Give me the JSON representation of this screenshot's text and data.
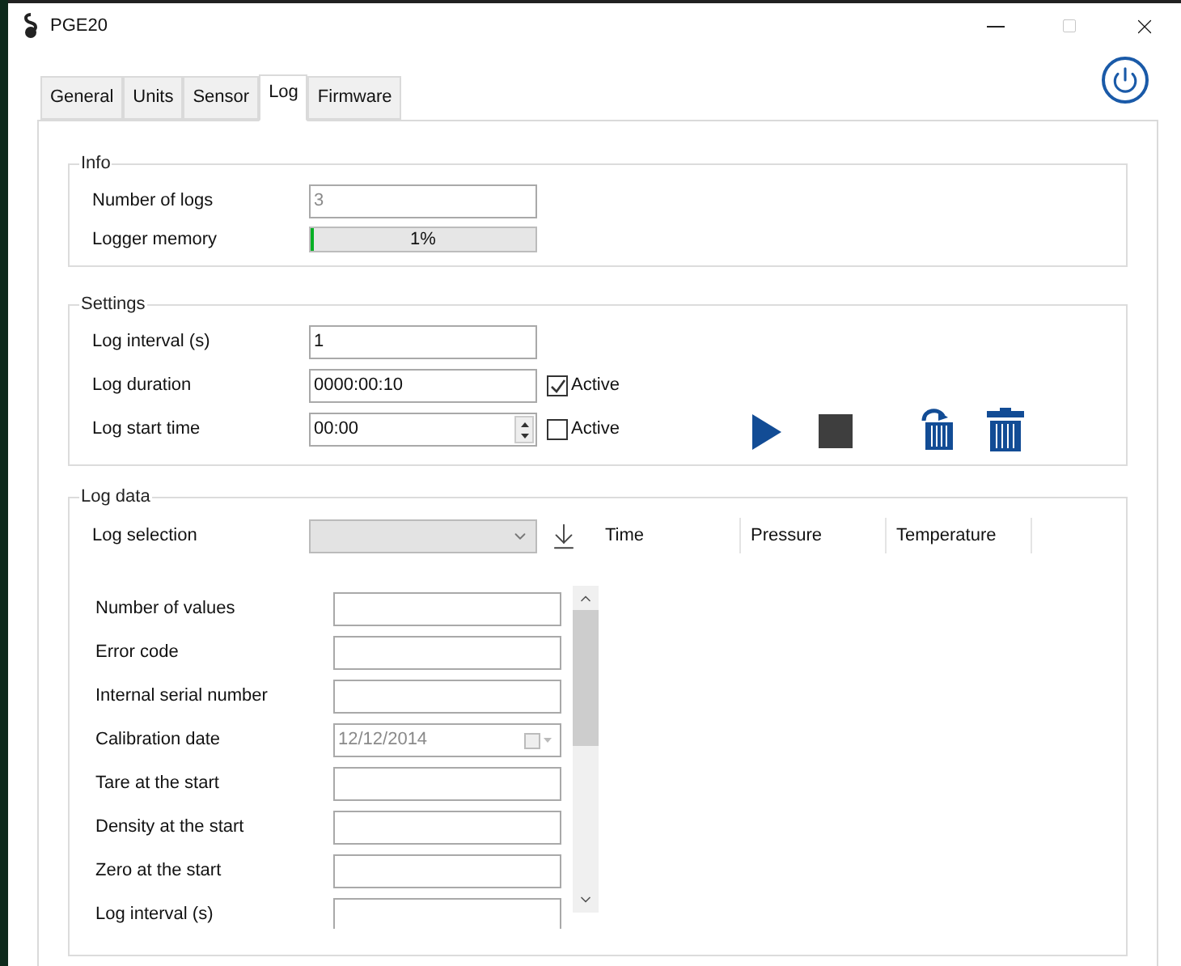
{
  "window": {
    "title": "PGE20"
  },
  "tabs": [
    {
      "label": "General",
      "selected": false
    },
    {
      "label": "Units",
      "selected": false
    },
    {
      "label": "Sensor",
      "selected": false
    },
    {
      "label": "Log",
      "selected": true
    },
    {
      "label": "Firmware",
      "selected": false
    }
  ],
  "info": {
    "title": "Info",
    "number_of_logs": {
      "label": "Number of logs",
      "value": "3",
      "disabled": true
    },
    "logger_memory": {
      "label": "Logger memory",
      "level": 0.01,
      "reading": "1%"
    }
  },
  "settings": {
    "title": "Settings",
    "rows": [
      {
        "kind": "text",
        "label": "Log interval (s)",
        "value": "1"
      },
      {
        "kind": "text",
        "label": "Log duration",
        "value": "0000:00:10",
        "active": {
          "label": "Active",
          "checked": true
        }
      },
      {
        "kind": "spin",
        "label": "Log start time",
        "value": "00:00",
        "active": {
          "label": "Active",
          "checked": false
        }
      }
    ]
  },
  "log_data": {
    "title": "Log data",
    "selection_label": "Log selection",
    "columns": [
      "Time",
      "Pressure",
      "Temperature"
    ],
    "fields": [
      {
        "kind": "text",
        "label": "Number of values"
      },
      {
        "kind": "text",
        "label": "Error code"
      },
      {
        "kind": "text",
        "label": "Internal serial number"
      },
      {
        "kind": "date",
        "label": "Calibration date",
        "value": "12/12/2014"
      },
      {
        "kind": "text",
        "label": "Tare at the start"
      },
      {
        "kind": "text",
        "label": "Density at the start"
      },
      {
        "kind": "text",
        "label": "Zero at the start"
      },
      {
        "kind": "text",
        "label": "Log interval (s)"
      }
    ]
  }
}
